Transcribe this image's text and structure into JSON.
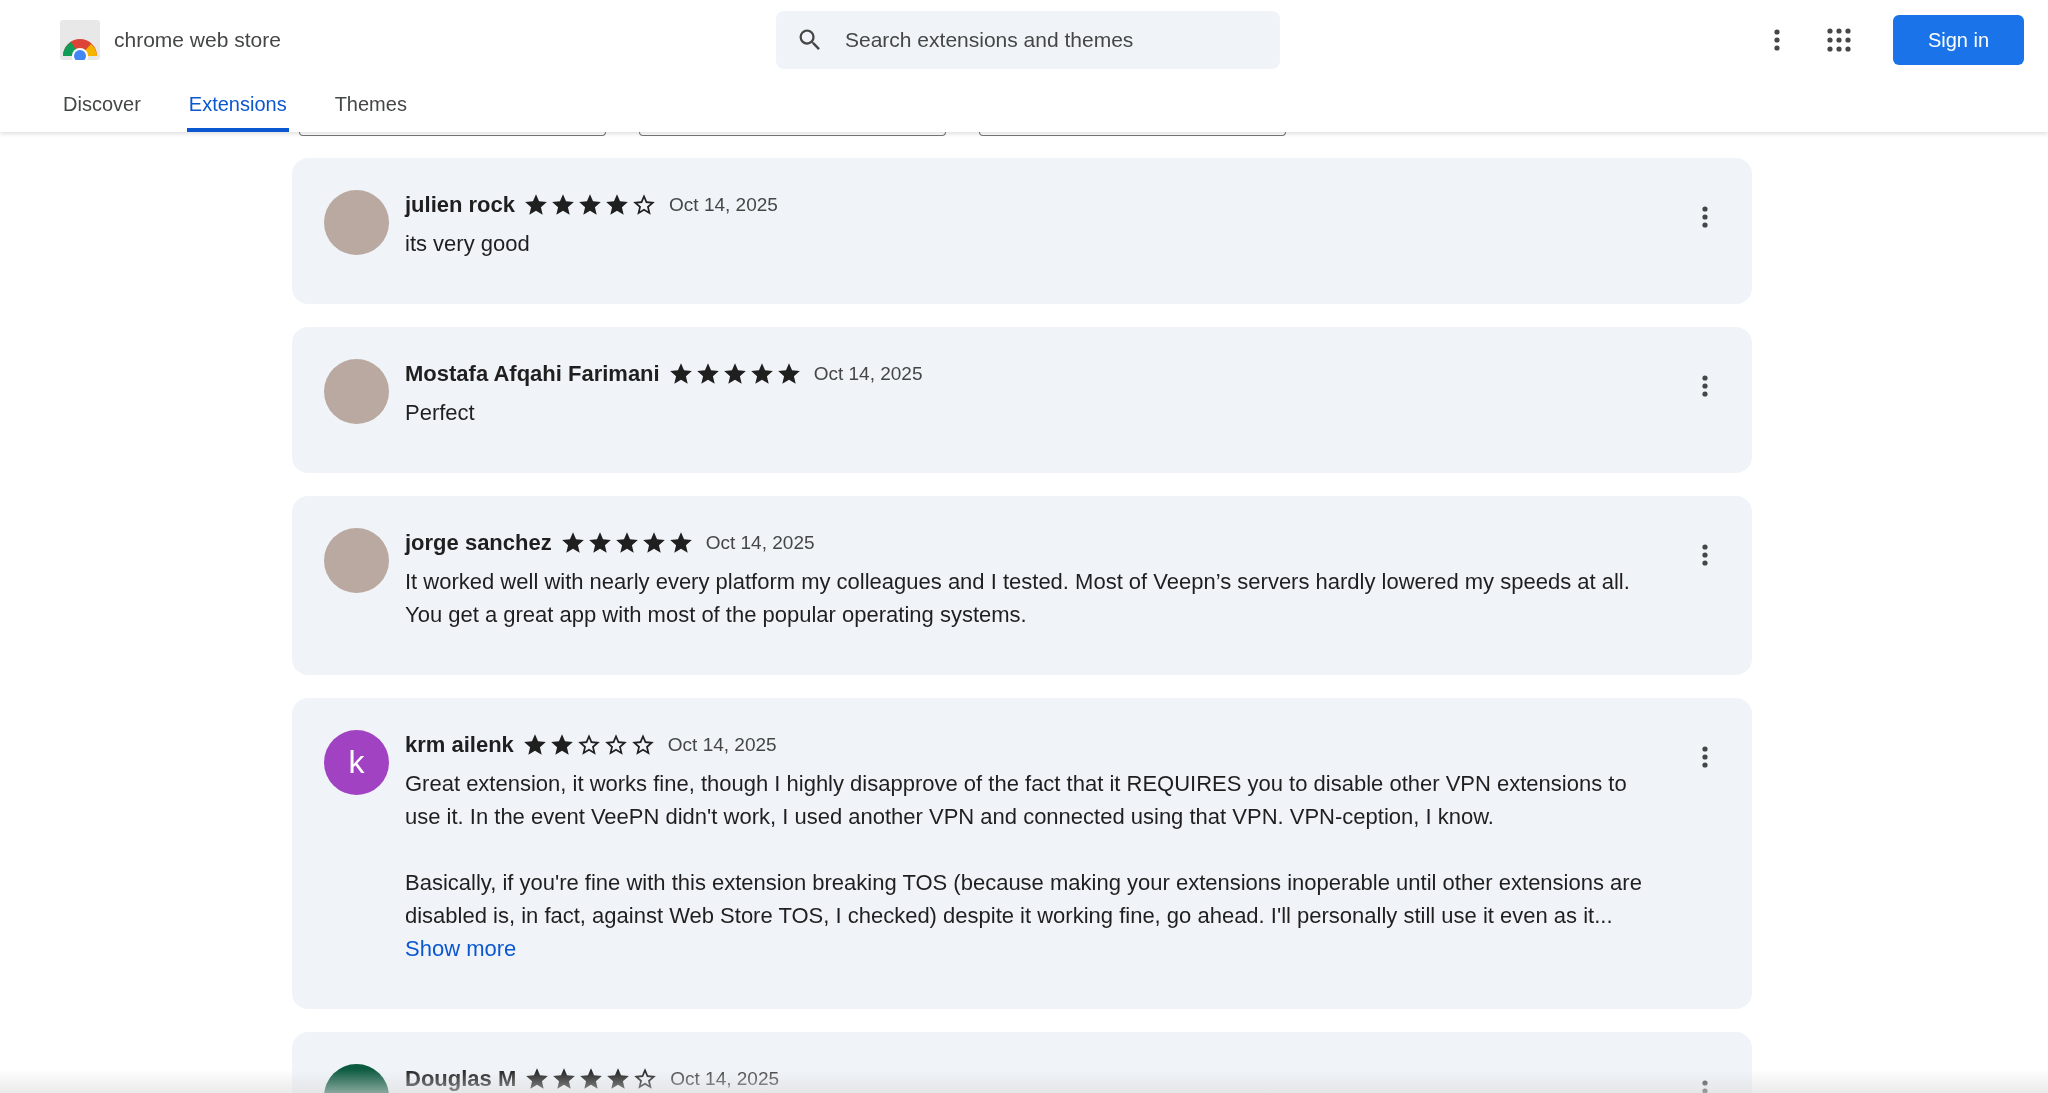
{
  "header": {
    "logo_text": "chrome web store",
    "search": {
      "placeholder": "Search extensions and themes"
    },
    "sign_in": "Sign in"
  },
  "tabs": [
    {
      "label": "Discover",
      "selected": false
    },
    {
      "label": "Extensions",
      "selected": true
    },
    {
      "label": "Themes",
      "selected": false
    }
  ],
  "reviews": [
    {
      "author": "julien rock",
      "avatar": {
        "kind": "photo"
      },
      "stars": 4,
      "date": "Oct 14, 2025",
      "paragraphs": [
        "its very good"
      ]
    },
    {
      "author": "Mostafa Afqahi Farimani",
      "avatar": {
        "kind": "photo"
      },
      "stars": 5,
      "date": "Oct 14, 2025",
      "paragraphs": [
        "Perfect"
      ]
    },
    {
      "author": "jorge sanchez",
      "avatar": {
        "kind": "photo"
      },
      "stars": 5,
      "date": "Oct 14, 2025",
      "paragraphs": [
        "It worked well with nearly every platform my colleagues and I tested. Most of Veepn’s servers hardly lowered my speeds at all. You get a great app with most of the popular operating systems."
      ]
    },
    {
      "author": "krm ailenk",
      "avatar": {
        "kind": "letter",
        "letter": "k",
        "color": "#a142c2"
      },
      "stars": 2,
      "date": "Oct 14, 2025",
      "paragraphs": [
        "Great extension, it works fine, though I highly disapprove of the fact that it REQUIRES you to disable other VPN extensions to use it. In the event VeePN didn't work, I used another VPN and connected using that VPN. VPN-ception, I know.",
        "Basically, if you're fine with this extension breaking TOS (because making your extensions inoperable until other extensions are disabled is, in fact, against Web Store TOS, I checked) despite it working fine, go ahead. I'll personally still use it even as it..."
      ],
      "show_more": "Show more"
    },
    {
      "author": "Douglas M",
      "avatar": {
        "kind": "letter",
        "color": "#0b5a3f"
      },
      "stars": 4,
      "date": "Oct 14, 2025"
    }
  ]
}
